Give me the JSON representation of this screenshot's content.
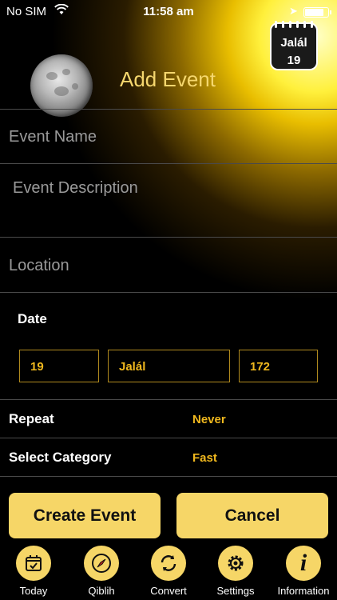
{
  "status_bar": {
    "carrier": "No SIM",
    "time": "11:58 am",
    "battery_level": 0.85
  },
  "calendar_badge": {
    "month": "Jalál",
    "day": "19"
  },
  "header": {
    "title": "Add Event"
  },
  "form": {
    "event_name_placeholder": "Event Name",
    "event_description_placeholder": "Event Description",
    "location_placeholder": "Location",
    "date_label": "Date",
    "date_day": "19",
    "date_month": "Jalál",
    "date_year": "172",
    "repeat_label": "Repeat",
    "repeat_value": "Never",
    "category_label": "Select Category",
    "category_value": "Fast"
  },
  "buttons": {
    "create": "Create Event",
    "cancel": "Cancel"
  },
  "tabs": [
    {
      "label": "Today",
      "icon": "calendar-check-icon"
    },
    {
      "label": "Qiblih",
      "icon": "compass-icon"
    },
    {
      "label": "Convert",
      "icon": "refresh-icon"
    },
    {
      "label": "Settings",
      "icon": "gear-icon"
    },
    {
      "label": "Information",
      "icon": "info-icon"
    }
  ],
  "colors": {
    "accent": "#f6d667",
    "value_text": "#f0b81e",
    "background": "#000000"
  }
}
